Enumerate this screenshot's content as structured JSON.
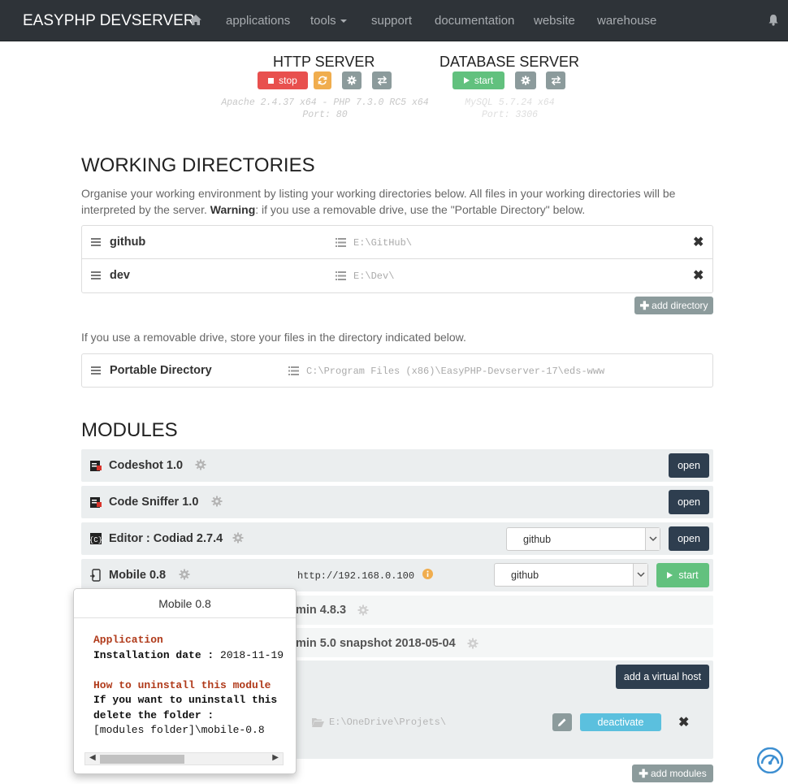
{
  "navbar": {
    "brand": "EASYPHP DEVSERVER",
    "items": [
      "applications",
      "tools",
      "support",
      "documentation",
      "website",
      "warehouse"
    ]
  },
  "http_server": {
    "title": "HTTP SERVER",
    "stop_label": "stop",
    "info_line1": "Apache 2.4.37 x64 - PHP 7.3.0 RC5 x64",
    "info_line2": "Port: 80"
  },
  "database_server": {
    "title": "DATABASE SERVER",
    "start_label": "start",
    "info_line1": "MySQL 5.7.24 x64",
    "info_line2": "Port: 3306"
  },
  "working_directories": {
    "title": "WORKING DIRECTORIES",
    "description_1": "Organise your working environment by listing your working directories below. All files in your working directories will be interpreted by the server. ",
    "warning_label": "Warning",
    "description_2": ": if you use a removable drive, use the \"Portable Directory\" below.",
    "rows": [
      {
        "name": "github",
        "path": "E:\\GitHub\\"
      },
      {
        "name": "dev",
        "path": "E:\\Dev\\"
      }
    ],
    "add_label": "add directory",
    "portable_note": "If you use a removable drive, store your files in the directory indicated below.",
    "portable": {
      "name": "Portable Directory",
      "path": "C:\\Program Files (x86)\\EasyPHP-Devserver-17\\eds-www"
    }
  },
  "modules": {
    "title": "MODULES",
    "open_label": "open",
    "start_label": "start",
    "items": [
      {
        "name": "Codeshot 1.0"
      },
      {
        "name": "Code Sniffer 1.0"
      },
      {
        "name": "Editor : Codiad 2.7.4",
        "select": "github"
      },
      {
        "name": "Mobile 0.8",
        "url": "http://192.168.0.100",
        "select": "github"
      },
      {
        "name_tail": "min 4.8.3"
      },
      {
        "name_tail": "min 5.0 snapshot 2018-05-04"
      }
    ],
    "add_virtual_host": "add a virtual host",
    "vhost_path": "E:\\OneDrive\\Projets\\",
    "deactivate_label": "deactivate",
    "add_modules": "add modules"
  },
  "popover": {
    "title": "Mobile 0.8",
    "section1_heading": "Application",
    "install_label": "Installation date : ",
    "install_value": "2018-11-19",
    "section2_heading": "How to uninstall this module",
    "line1": "If you want to uninstall this",
    "line2": "delete the folder :",
    "line3": "[modules folder]\\mobile-0.8"
  },
  "colors": {
    "navbar_bg": "#2e3338",
    "stop_red": "#e8504e",
    "start_green": "#62c17e",
    "open_dark": "#2e3e4f",
    "deactivate_blue": "#5bc0de"
  }
}
